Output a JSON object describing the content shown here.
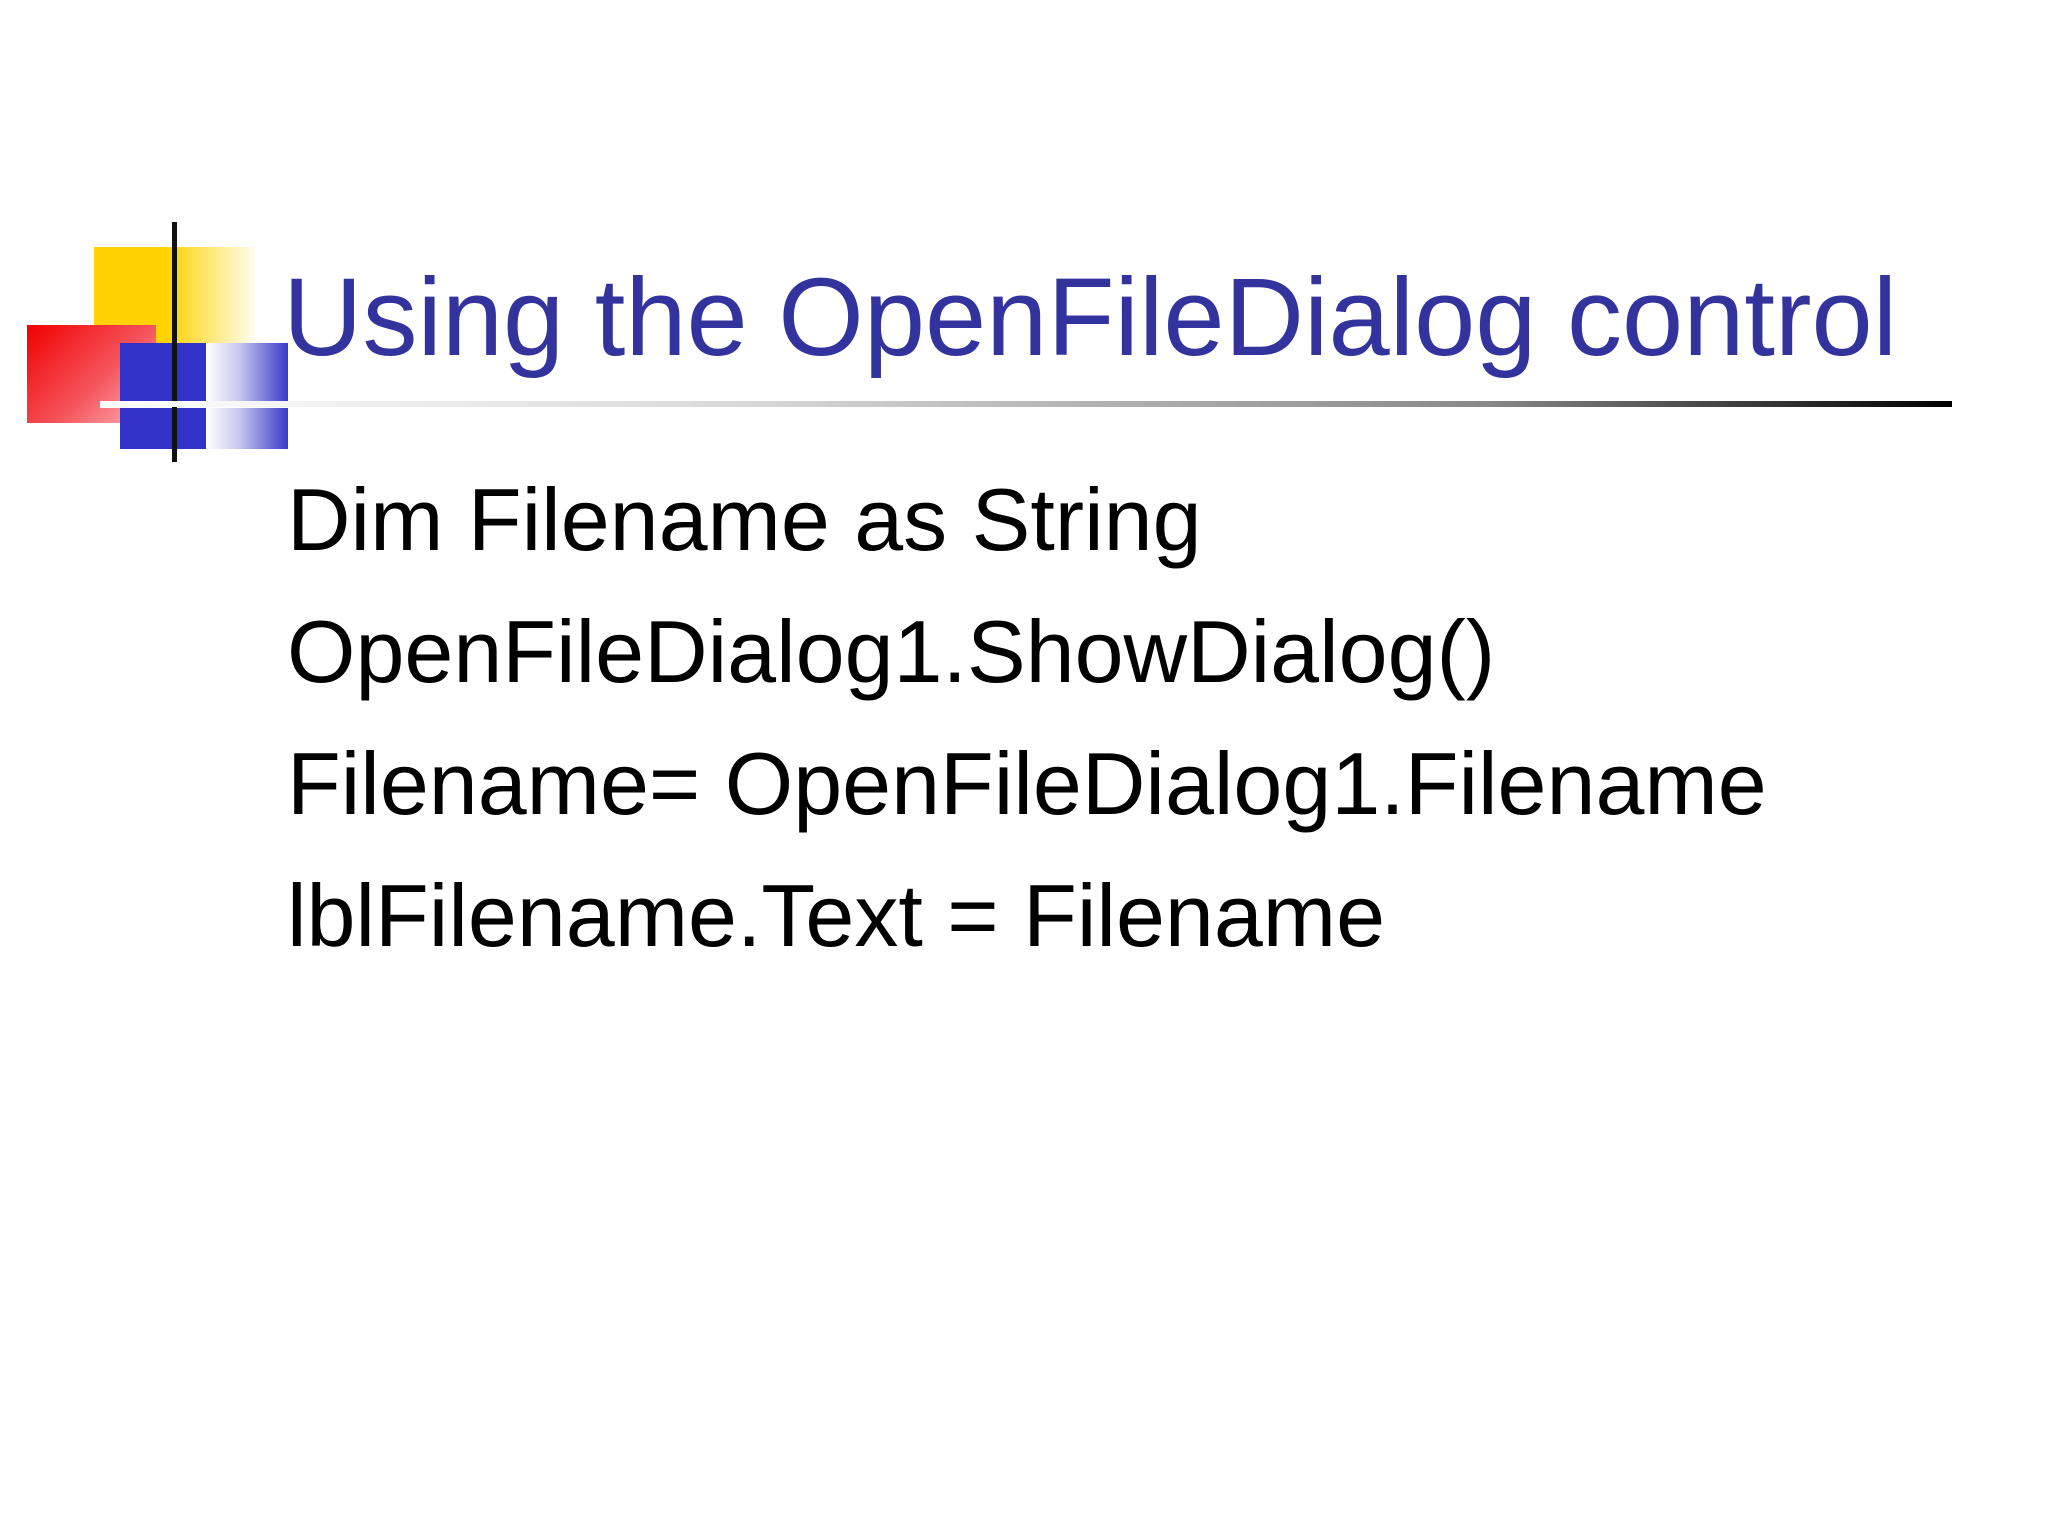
{
  "slide": {
    "title": "Using the OpenFileDialog control",
    "lines": [
      "Dim Filename as String",
      "OpenFileDialog1.ShowDialog()",
      "Filename= OpenFileDialog1.Filename",
      "lblFilename.Text = Filename"
    ]
  },
  "colors": {
    "title": "#33339e",
    "text": "#000000",
    "accent_yellow": "#ffd200",
    "accent_red": "#f00000",
    "accent_blue": "#3232c8"
  }
}
